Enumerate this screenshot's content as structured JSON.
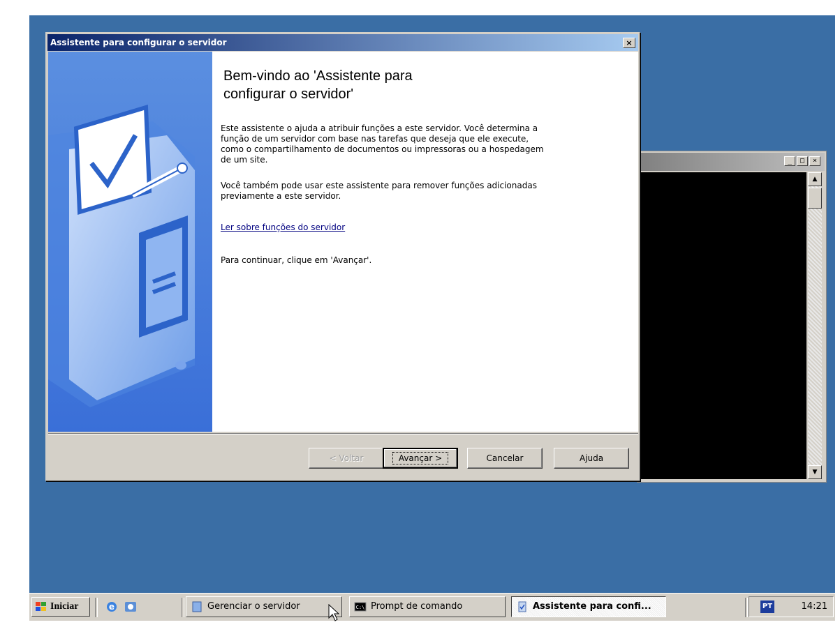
{
  "wizard": {
    "title": "Assistente para configurar o servidor",
    "close_label": "×",
    "heading_line1": "Bem-vindo ao 'Assistente para",
    "heading_line2": "configurar o servidor'",
    "para1_line1": "Este assistente o ajuda a atribuir funções a este servidor. Você determina a",
    "para1_line2": "função de um servidor com base nas tarefas que deseja que ele execute,",
    "para1_line3": "como o compartilhamento de documentos ou impressoras ou a hospedagem",
    "para1_line4": "de um site.",
    "para2_line1": "Você também pode usar este assistente para remover funções adicionadas",
    "para2_line2": "previamente a este servidor.",
    "link": "Ler sobre funções do servidor",
    "continue": "Para continuar, clique em 'Avançar'.",
    "buttons": {
      "back": "< Voltar",
      "next": "Avançar >",
      "cancel": "Cancelar",
      "help": "Ajuda"
    }
  },
  "console": {
    "minimize": "_",
    "maximize": "□",
    "close": "×"
  },
  "taskbar": {
    "start": "Iniciar",
    "tasks": [
      {
        "label": "Gerenciar o servidor",
        "active": false
      },
      {
        "label": "Prompt de comando",
        "active": false
      },
      {
        "label": "Assistente para confi...",
        "active": true
      }
    ],
    "language": "PT",
    "clock": "14:21"
  },
  "colors": {
    "desktop": "#3a6ea5",
    "title_active_start": "#0a246a",
    "title_active_end": "#a6caf0",
    "face": "#d4d0c8"
  }
}
